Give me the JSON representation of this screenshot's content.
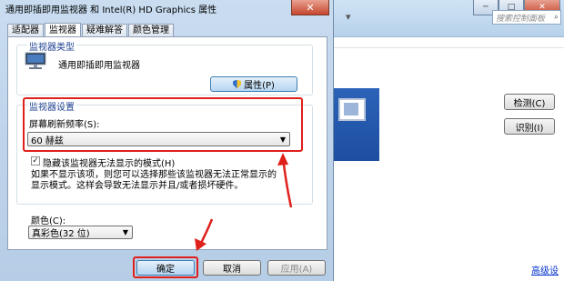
{
  "dialog": {
    "title": "通用即插即用监视器 和 Intel(R) HD Graphics 属性",
    "close_glyph": "✕",
    "tabs": [
      "适配器",
      "监视器",
      "疑难解答",
      "颜色管理"
    ],
    "active_tab_index": 1,
    "monitor_type": {
      "group_title": "监视器类型",
      "monitor_name": "通用即插即用监视器",
      "properties_button": "属性(P)"
    },
    "monitor_settings": {
      "group_title": "监视器设置",
      "refresh_label": "屏幕刷新频率(S):",
      "refresh_value": "60 赫兹",
      "hide_modes_label": "隐藏该监视器无法显示的模式(H)",
      "hide_modes_checked": true,
      "description_line1": "如果不显示该项，则您可以选择那些该监视器无法正常显示的",
      "description_line2": "显示模式。这样会导致无法显示并且/或者损坏硬件。"
    },
    "colors": {
      "label": "颜色(C):",
      "value": "真彩色(32 位)"
    },
    "buttons": {
      "ok": "确定",
      "cancel": "取消",
      "apply": "应用(A)"
    }
  },
  "background_window": {
    "nav_glyph": "▾",
    "minimize": "─",
    "maximize": "□",
    "close": "✕",
    "search_placeholder": "搜索控制面板",
    "search_icon": "⌕",
    "detect_button": "检测(C)",
    "identify_button": "识别(I)",
    "advanced_link": "高级设"
  },
  "annotation_color": "#e0201b"
}
